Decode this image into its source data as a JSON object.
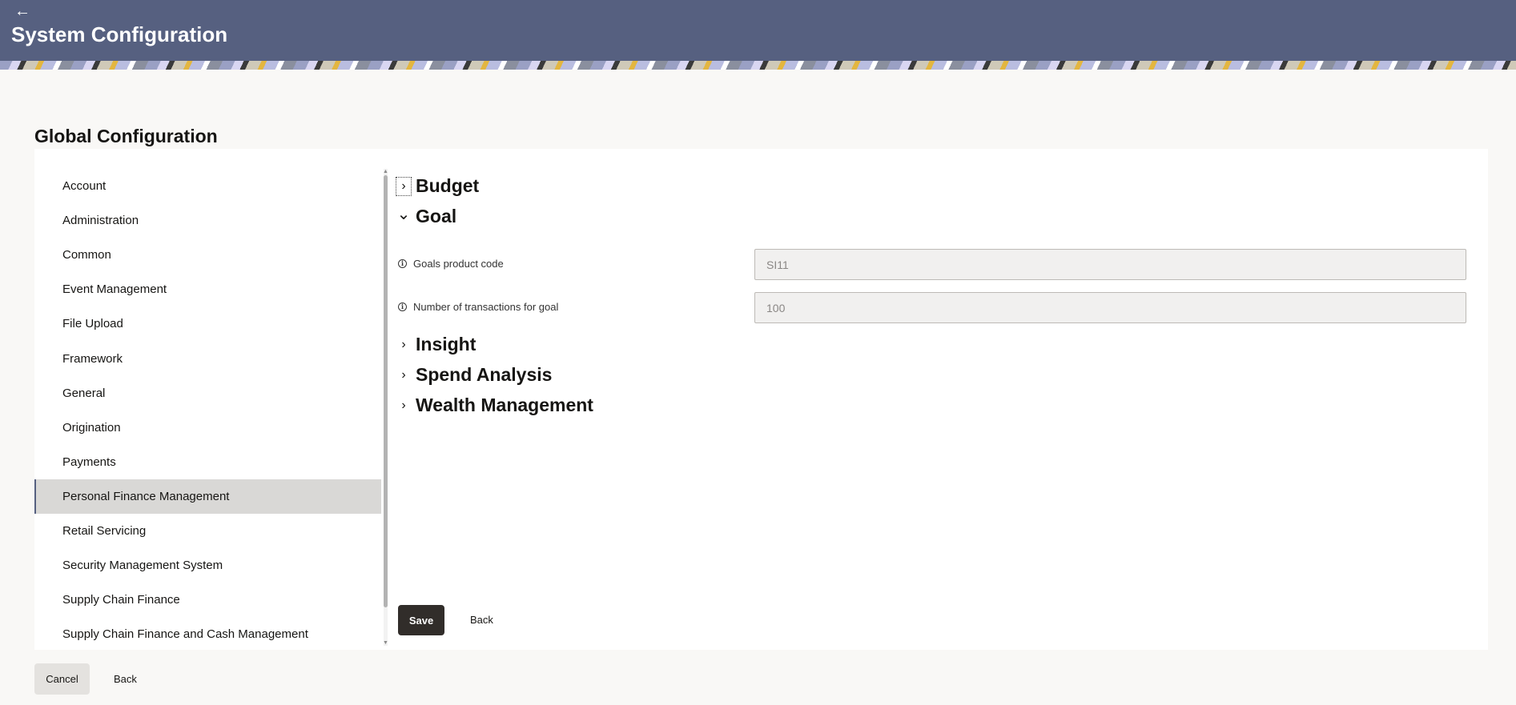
{
  "header": {
    "back_icon": "←",
    "title": "System Configuration"
  },
  "section_title": "Global Configuration",
  "nav": {
    "items": [
      {
        "label": "Account"
      },
      {
        "label": "Administration"
      },
      {
        "label": "Common"
      },
      {
        "label": "Event Management"
      },
      {
        "label": "File Upload"
      },
      {
        "label": "Framework"
      },
      {
        "label": "General"
      },
      {
        "label": "Origination"
      },
      {
        "label": "Payments"
      },
      {
        "label": "Personal Finance Management",
        "active": true
      },
      {
        "label": "Retail Servicing"
      },
      {
        "label": "Security Management System"
      },
      {
        "label": "Supply Chain Finance"
      },
      {
        "label": "Supply Chain Finance and Cash Management"
      }
    ]
  },
  "accordion": {
    "budget": {
      "label": "Budget",
      "expanded": false
    },
    "goal": {
      "label": "Goal",
      "expanded": true,
      "fields": [
        {
          "label": "Goals product code",
          "value": "SI11"
        },
        {
          "label": "Number of transactions for goal",
          "value": "100"
        }
      ]
    },
    "insight": {
      "label": "Insight",
      "expanded": false
    },
    "spend_analysis": {
      "label": "Spend Analysis",
      "expanded": false
    },
    "wealth_management": {
      "label": "Wealth Management",
      "expanded": false
    }
  },
  "icons": {
    "chevron_right": "›",
    "chevron_down": "⌄",
    "info": "i"
  },
  "actions": {
    "save": "Save",
    "back": "Back",
    "cancel": "Cancel",
    "footer_back": "Back"
  },
  "colors": {
    "header_bg": "#566080",
    "save_bg": "#312d2a",
    "active_nav_bg": "#d9d8d6"
  }
}
